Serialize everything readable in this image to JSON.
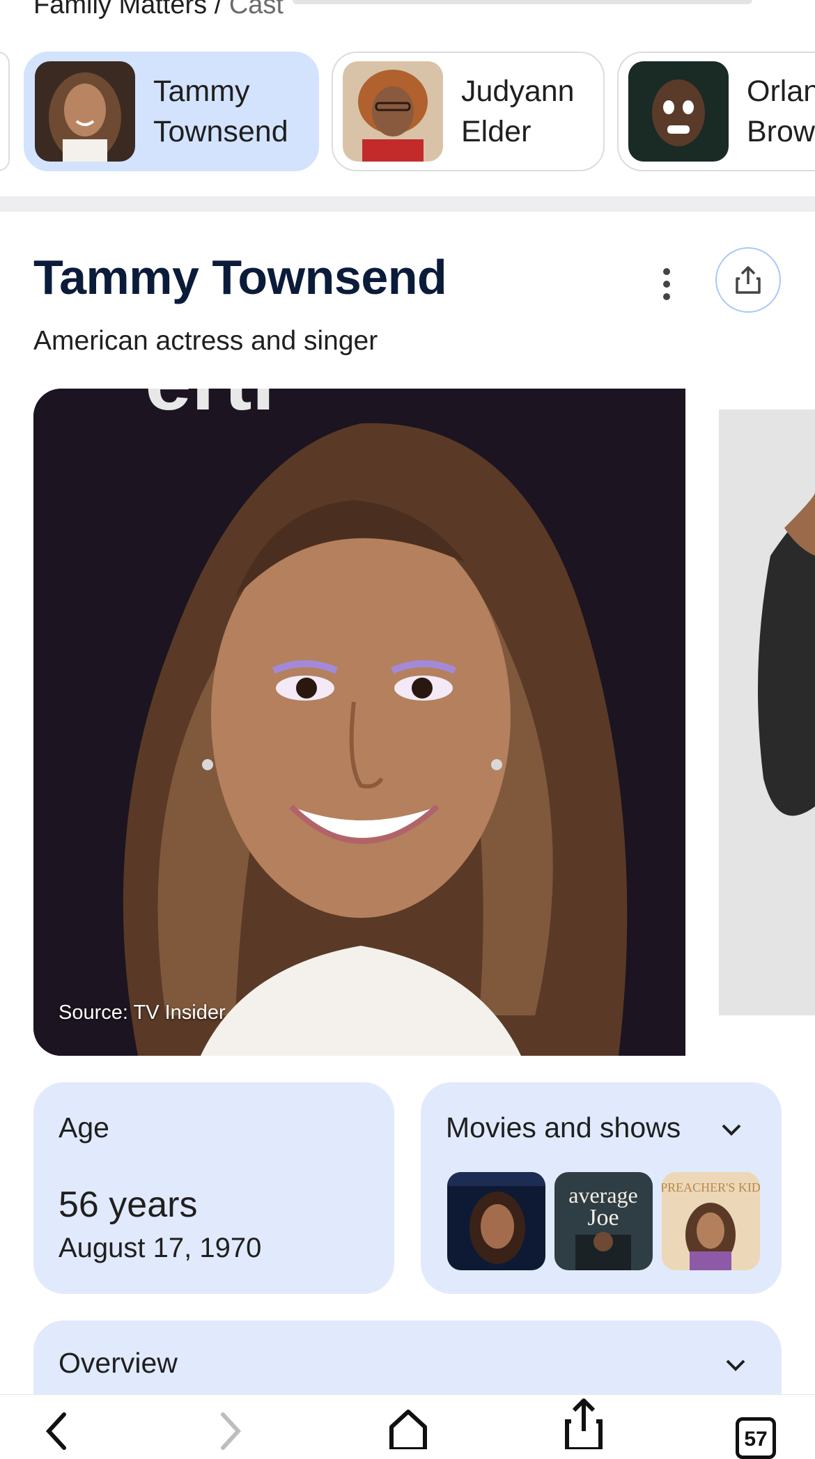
{
  "breadcrumb": {
    "show": "Family Matters",
    "separator": " / ",
    "section": "Cast"
  },
  "cast": [
    {
      "first": "Tammy",
      "last": "Townsend",
      "active": true
    },
    {
      "first": "Judyann",
      "last": "Elder",
      "active": false
    },
    {
      "first": "Orlando",
      "last": "Brown",
      "active": false
    }
  ],
  "entity": {
    "name": "Tammy Townsend",
    "description": "American actress and singer",
    "image_source": "Source: TV Insider"
  },
  "age_card": {
    "label": "Age",
    "value": "56 years",
    "birth_date": "August 17, 1970"
  },
  "movies_card": {
    "label": "Movies and shows",
    "posters": [
      {
        "icon": "movie-poster-icon"
      },
      {
        "icon": "movie-poster-icon",
        "text": "average Joe"
      },
      {
        "icon": "movie-poster-icon",
        "text": "Preacher's Kid"
      }
    ]
  },
  "overview": {
    "label": "Overview"
  },
  "toolbar": {
    "tabs_count": "57"
  },
  "colors": {
    "accent": "#d3e3fd",
    "card": "#e1eafc",
    "title": "#0b1b3a"
  }
}
